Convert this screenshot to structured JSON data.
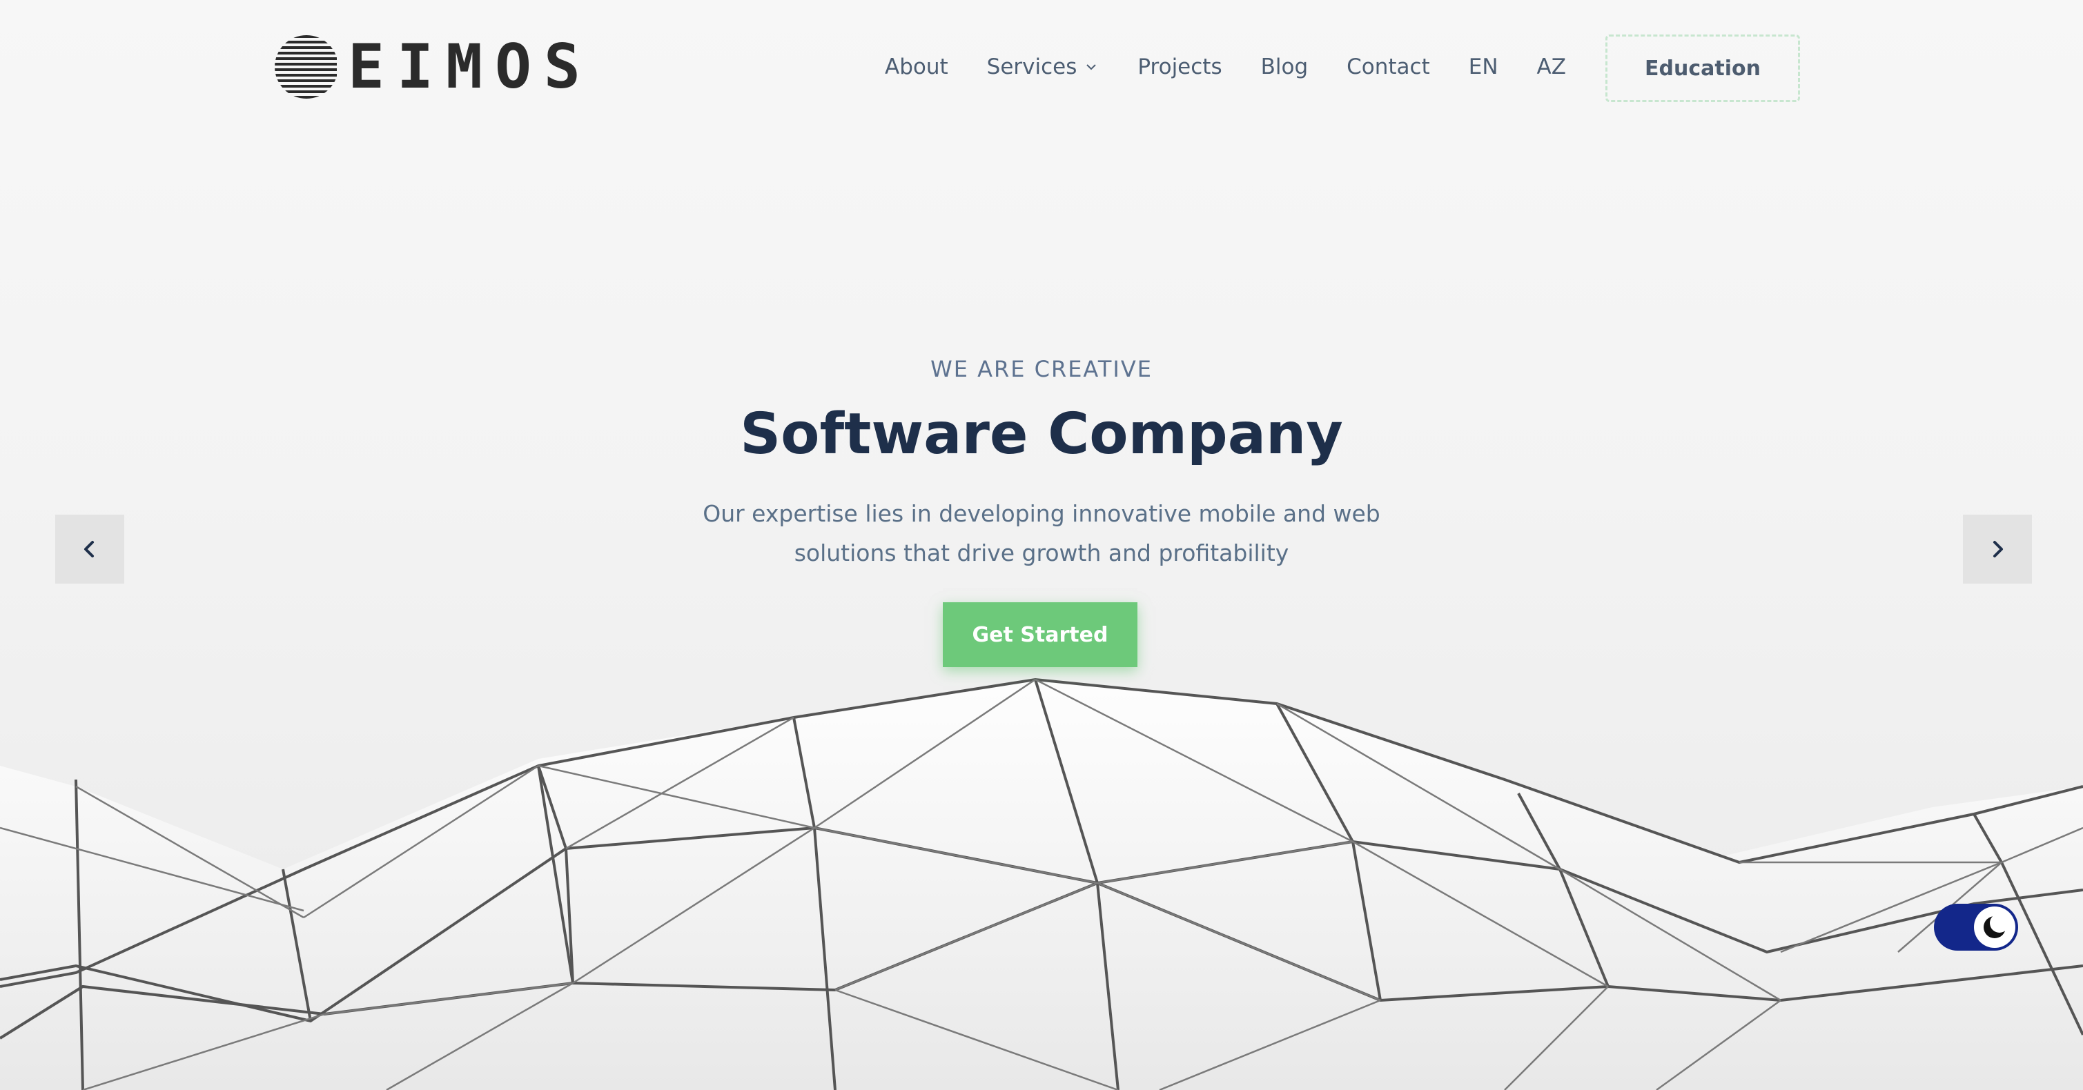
{
  "brand": {
    "logo_text": "EIMOS"
  },
  "nav": {
    "items": [
      {
        "label": "About"
      },
      {
        "label": "Services",
        "has_dropdown": true
      },
      {
        "label": "Projects"
      },
      {
        "label": "Blog"
      },
      {
        "label": "Contact"
      },
      {
        "label": "EN"
      },
      {
        "label": "AZ"
      }
    ],
    "cta_label": "Education"
  },
  "hero": {
    "eyebrow": "WE ARE CREATIVE",
    "title": "Software Company",
    "description_line1": "Our expertise lies in developing innovative mobile and web",
    "description_line2": "solutions that drive growth and profitability",
    "button_label": "Get Started"
  },
  "slider": {
    "prev_icon": "chevron-left-icon",
    "next_icon": "chevron-right-icon"
  },
  "theme_toggle": {
    "icon": "moon-icon",
    "state": "dark-mode-off"
  },
  "colors": {
    "accent_green": "#6dc97a",
    "title_navy": "#1e2f4a",
    "text_slate": "#5a7088",
    "toggle_blue": "#13278a"
  }
}
